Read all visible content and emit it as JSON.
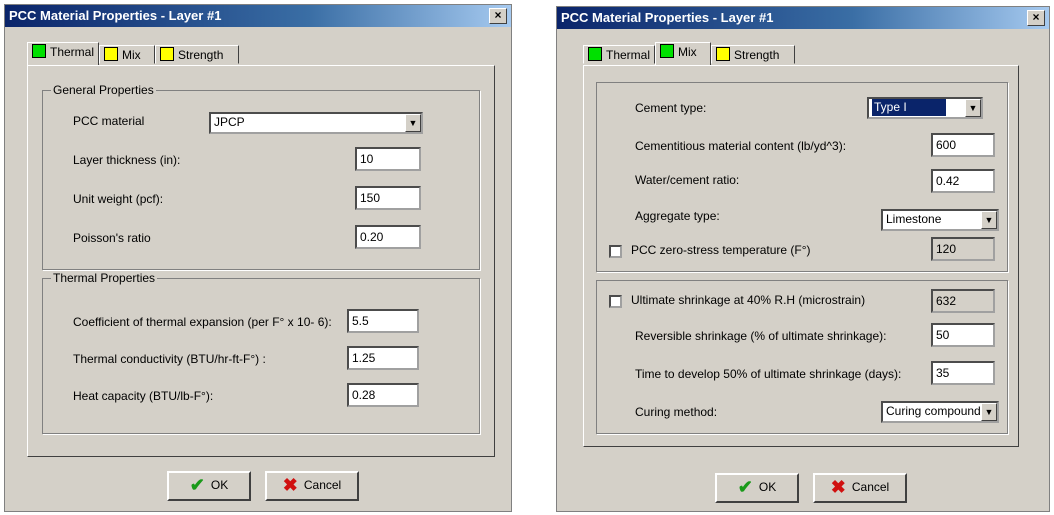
{
  "left": {
    "title": "PCC Material Properties - Layer #1",
    "close": "×",
    "tabs": {
      "thermal": "Thermal",
      "mix": "Mix",
      "strength": "Strength"
    },
    "general": {
      "legend": "General Properties",
      "material_label": "PCC material",
      "material_value": "JPCP",
      "thickness_label": "Layer thickness (in):",
      "thickness_value": "10",
      "unit_weight_label": "Unit weight (pcf):",
      "unit_weight_value": "150",
      "poisson_label": "Poisson's ratio",
      "poisson_value": "0.20"
    },
    "thermal": {
      "legend": "Thermal Properties",
      "cte_label": "Coefficient of thermal expansion (per F° x 10- 6):",
      "cte_value": "5.5",
      "conductivity_label": "Thermal conductivity (BTU/hr-ft-F°) :",
      "conductivity_value": "1.25",
      "heat_label": "Heat capacity (BTU/lb-F°):",
      "heat_value": "0.28"
    },
    "buttons": {
      "ok": "OK",
      "cancel": "Cancel"
    }
  },
  "right": {
    "title": "PCC Material Properties - Layer #1",
    "close": "×",
    "tabs": {
      "thermal": "Thermal",
      "mix": "Mix",
      "strength": "Strength"
    },
    "mix": {
      "cement_label": "Cement type:",
      "cement_value": "Type I",
      "content_label": "Cementitious material content (lb/yd^3):",
      "content_value": "600",
      "wc_label": "Water/cement ratio:",
      "wc_value": "0.42",
      "aggregate_label": "Aggregate type:",
      "aggregate_value": "Limestone",
      "zero_stress_label": "PCC zero-stress temperature (F°)",
      "zero_stress_value": "120"
    },
    "shrinkage": {
      "ultimate_label": "Ultimate shrinkage at 40% R.H (microstrain)",
      "ultimate_value": "632",
      "reversible_label": "Reversible shrinkage (% of ultimate shrinkage):",
      "reversible_value": "50",
      "time_label": "Time to develop 50% of ultimate shrinkage (days):",
      "time_value": "35",
      "curing_label": "Curing method:",
      "curing_value": "Curing compound"
    },
    "buttons": {
      "ok": "OK",
      "cancel": "Cancel"
    }
  },
  "colors": {
    "title_start": "#0a246a",
    "title_end": "#a6caf0",
    "tab_green": "#00e000",
    "tab_yellow": "#ffff00",
    "face": "#d4d0c8"
  },
  "icons": {
    "ok": "check-icon",
    "cancel": "x-icon"
  }
}
